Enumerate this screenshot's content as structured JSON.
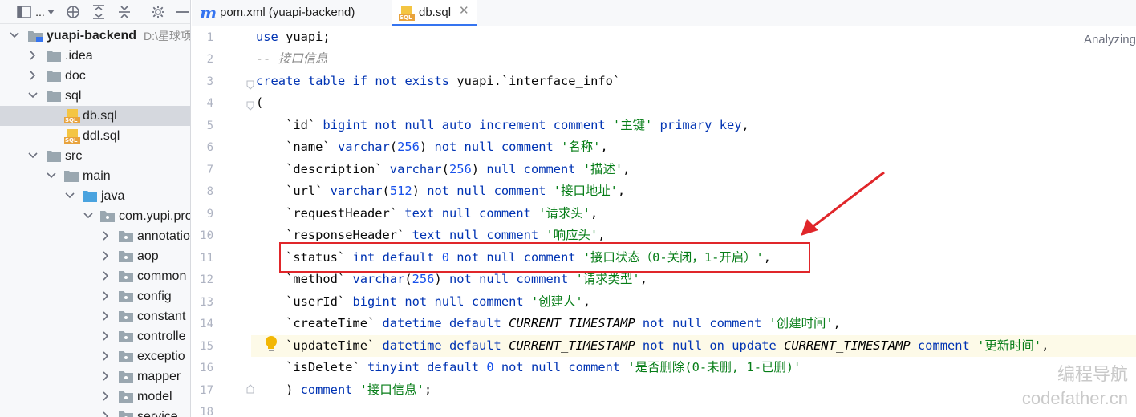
{
  "project_panel": {
    "toolbar": {
      "view_label": "...",
      "icons": [
        "project-view-icon",
        "dropdown-icon",
        "locate-icon",
        "expand-all-icon",
        "collapse-all-icon",
        "gear-icon",
        "hide-icon"
      ]
    },
    "root": {
      "name": "yuapi-backend",
      "path": "D:\\星球项"
    },
    "items": [
      {
        "label": ".idea",
        "type": "folder"
      },
      {
        "label": "doc",
        "type": "folder"
      },
      {
        "label": "sql",
        "type": "folder"
      },
      {
        "label": "db.sql",
        "type": "sql"
      },
      {
        "label": "ddl.sql",
        "type": "sql"
      },
      {
        "label": "src",
        "type": "folder"
      },
      {
        "label": "main",
        "type": "folder"
      },
      {
        "label": "java",
        "type": "folder"
      },
      {
        "label": "com.yupi.pro",
        "type": "package"
      },
      {
        "label": "annotatio",
        "type": "package"
      },
      {
        "label": "aop",
        "type": "package"
      },
      {
        "label": "common",
        "type": "package"
      },
      {
        "label": "config",
        "type": "package"
      },
      {
        "label": "constant",
        "type": "package"
      },
      {
        "label": "controlle",
        "type": "package"
      },
      {
        "label": "exceptio",
        "type": "package"
      },
      {
        "label": "mapper",
        "type": "package"
      },
      {
        "label": "model",
        "type": "package"
      },
      {
        "label": "service",
        "type": "package"
      }
    ],
    "sql_badge": "SQL"
  },
  "tabs": [
    {
      "icon_letter": "m",
      "label": "pom.xml (yuapi-backend)",
      "active": false
    },
    {
      "icon_letter": "SQL",
      "label": "db.sql",
      "active": true
    }
  ],
  "editor": {
    "status": "Analyzing",
    "line_numbers": [
      "1",
      "2",
      "3",
      "4",
      "5",
      "6",
      "7",
      "8",
      "9",
      "10",
      "11",
      "12",
      "13",
      "14",
      "15",
      "16",
      "17",
      "18"
    ],
    "lines": [
      "use yuapi;",
      "-- 接口信息",
      "create table if not exists yuapi.`interface_info`",
      "(",
      "    `id` bigint not null auto_increment comment '主键' primary key,",
      "    `name` varchar(256) not null comment '名称',",
      "    `description` varchar(256) null comment '描述',",
      "    `url` varchar(512) not null comment '接口地址',",
      "    `requestHeader` text null comment '请求头',",
      "    `responseHeader` text null comment '响应头',",
      "    `status` int default 0 not null comment '接口状态（0-关闭，1-开启）',",
      "    `method` varchar(256) not null comment '请求类型',",
      "    `userId` bigint not null comment '创建人',",
      "    `createTime` datetime default CURRENT_TIMESTAMP not null comment '创建时间',",
      "    `updateTime` datetime default CURRENT_TIMESTAMP not null on update CURRENT_TIMESTAMP comment '更新时间',",
      "    `isDelete` tinyint default 0 not null comment '是否删除(0-未删, 1-已删)'",
      "    ) comment '接口信息';",
      ""
    ],
    "highlighted_line": "15"
  },
  "watermark": {
    "line1": "编程导航",
    "line2": "codefather.cn"
  },
  "colors": {
    "keyword": "#0033b3",
    "string": "#067d17",
    "number": "#1750eb",
    "comment": "#8c8c8c",
    "annotation": "#e0262a",
    "accent": "#3574f0"
  }
}
